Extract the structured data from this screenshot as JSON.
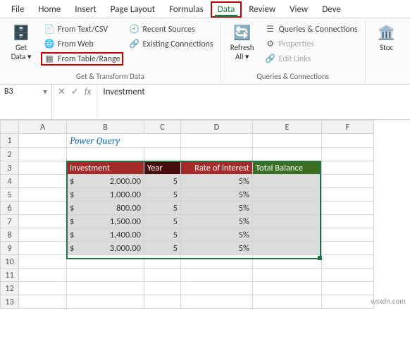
{
  "tabs": {
    "file": "File",
    "home": "Home",
    "insert": "Insert",
    "page_layout": "Page Layout",
    "formulas": "Formulas",
    "data": "Data",
    "review": "Review",
    "view": "View",
    "developer": "Deve"
  },
  "ribbon": {
    "get_data": {
      "label_line1": "Get",
      "label_line2": "Data"
    },
    "from_text_csv": "From Text/CSV",
    "from_web": "From Web",
    "from_table_range": "From Table/Range",
    "recent_sources": "Recent Sources",
    "existing_connections": "Existing Connections",
    "group1_label": "Get & Transform Data",
    "refresh_all": {
      "label_line1": "Refresh",
      "label_line2": "All"
    },
    "queries_connections": "Queries & Connections",
    "properties": "Properties",
    "edit_links": "Edit Links",
    "group2_label": "Queries & Connections",
    "stocks": "Stoc"
  },
  "namebox": "B3",
  "formula": "Investment",
  "sheet": {
    "title": "Power Query",
    "headers": {
      "investment": "Investment",
      "year": "Year",
      "rate": "Rate of interest",
      "total": "Total Balance"
    },
    "columns": [
      "A",
      "B",
      "C",
      "D",
      "E",
      "F"
    ],
    "row_labels": [
      "1",
      "2",
      "3",
      "4",
      "5",
      "6",
      "7",
      "8",
      "9",
      "10",
      "11",
      "12",
      "13"
    ],
    "rows": [
      {
        "investment": "2,000.00",
        "year": "5",
        "rate": "5%"
      },
      {
        "investment": "1,000.00",
        "year": "5",
        "rate": "5%"
      },
      {
        "investment": "800.00",
        "year": "5",
        "rate": "5%"
      },
      {
        "investment": "1,500.00",
        "year": "5",
        "rate": "5%"
      },
      {
        "investment": "1,400.00",
        "year": "5",
        "rate": "5%"
      },
      {
        "investment": "3,000.00",
        "year": "5",
        "rate": "5%"
      }
    ],
    "currency_symbol": "$"
  },
  "watermark": "wsxdn.com"
}
